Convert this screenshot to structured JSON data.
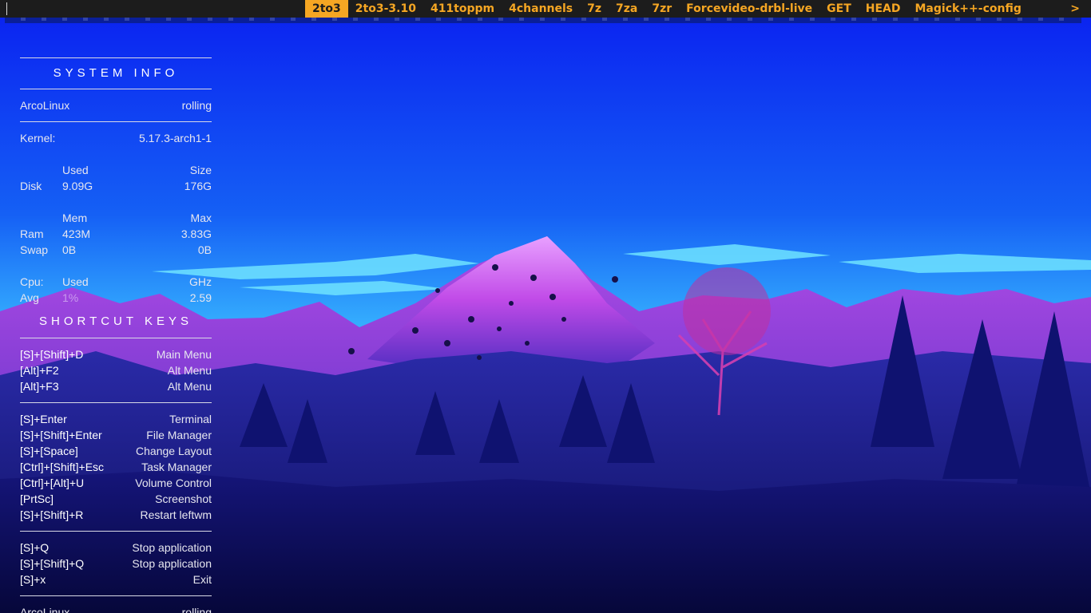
{
  "menu": {
    "items": [
      "2to3",
      "2to3-3.10",
      "411toppm",
      "4channels",
      "7z",
      "7za",
      "7zr",
      "Forcevideo-drbl-live",
      "GET",
      "HEAD",
      "Magick++-config"
    ],
    "selected": "2to3",
    "more_arrow": ">"
  },
  "colors": {
    "accent": "#f5a623",
    "bar_bg": "#1c1c1c",
    "text": "#e6e6ef"
  },
  "system_info": {
    "title": "SYSTEM INFO",
    "distro": "ArcoLinux",
    "release": "rolling",
    "kernel_label": "Kernel:",
    "kernel_value": "5.17.3-arch1-1",
    "disk_hdr_used": "Used",
    "disk_hdr_size": "Size",
    "disk_label": "Disk",
    "disk_used": "9.09G",
    "disk_size": "176G",
    "mem_hdr_mem": "Mem",
    "mem_hdr_max": "Max",
    "ram_label": "Ram",
    "ram_used": "423M",
    "ram_max": "3.83G",
    "swap_label": "Swap",
    "swap_used": "0B",
    "swap_max": "0B",
    "cpu_label": "Cpu:",
    "cpu_hdr_used": "Used",
    "cpu_hdr_ghz": "GHz",
    "avg_label": "Avg",
    "avg_used": "1%",
    "avg_ghz": "2.59"
  },
  "shortcuts": {
    "title": "SHORTCUT KEYS",
    "groups": [
      [
        {
          "keys": "[S]+[Shift]+D",
          "action": "Main Menu"
        },
        {
          "keys": "[Alt]+F2",
          "action": "Alt Menu"
        },
        {
          "keys": "[Alt]+F3",
          "action": "Alt Menu"
        }
      ],
      [
        {
          "keys": "[S]+Enter",
          "action": "Terminal"
        },
        {
          "keys": "[S]+[Shift]+Enter",
          "action": "File Manager"
        },
        {
          "keys": "[S]+[Space]",
          "action": "Change Layout"
        },
        {
          "keys": "[Ctrl]+[Shift]+Esc",
          "action": "Task Manager"
        },
        {
          "keys": "[Ctrl]+[Alt]+U",
          "action": "Volume Control"
        },
        {
          "keys": "[PrtSc]",
          "action": "Screenshot"
        },
        {
          "keys": "[S]+[Shift]+R",
          "action": "Restart leftwm"
        }
      ],
      [
        {
          "keys": "[S]+Q",
          "action": "Stop application"
        },
        {
          "keys": "[S]+[Shift]+Q",
          "action": "Stop application"
        },
        {
          "keys": "[S]+x",
          "action": "Exit"
        }
      ]
    ],
    "footer_left": "ArcoLinux",
    "footer_right": "rolling"
  }
}
